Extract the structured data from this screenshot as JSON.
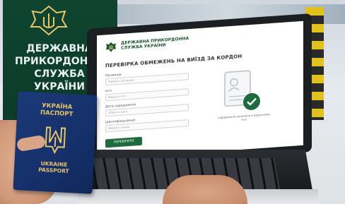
{
  "banner": {
    "lines": [
      "ДЕРЖАВНА",
      "ПРИКОРДОННА",
      "СЛУЖБА УКРАЇНИ"
    ]
  },
  "site": {
    "brand_line1": "ДЕРЖАВНА ПРИКОРДОННА",
    "brand_line2": "СЛУЖБА УКРАЇНИ",
    "brand_sub": "",
    "form_title": "ПЕРЕВІРКА ОБМЕЖЕНЬ НА ВИЇЗД ЗА КОРДОН",
    "fields": [
      {
        "label": "Прізвище",
        "placeholder": "Введіть прізвище"
      },
      {
        "label": "Ім'я",
        "placeholder": "Введіть ім'я"
      },
      {
        "label": "Дата народження",
        "placeholder": "Оберіть дату"
      },
      {
        "label": "Ідентифікаційний",
        "placeholder": "Введіть номер"
      }
    ],
    "submit_label": "ПЕРЕВІРИТИ",
    "info_note": "Інформацію оновлено в реальному часі"
  },
  "passport": {
    "top_line1": "УКРАЇНА",
    "top_line2": "ПАСПОРТ",
    "bottom_line1": "UKRAINE",
    "bottom_line2": "PASSPORT"
  },
  "colors": {
    "banner_green": "#0f4530",
    "brand_green": "#1c5a36",
    "passport_blue": "#1b3a78",
    "gold": "#e7c568",
    "check_green": "#1f6b3d"
  }
}
